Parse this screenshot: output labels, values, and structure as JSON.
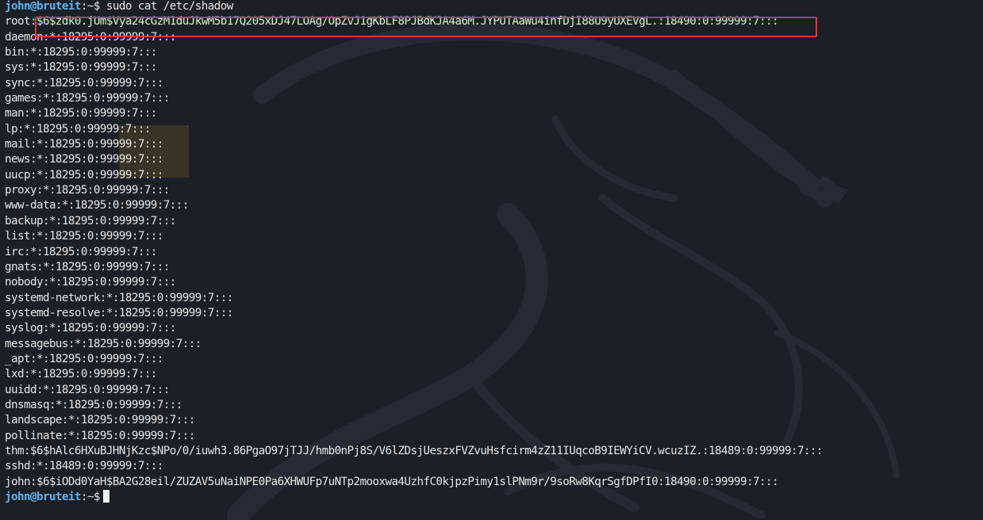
{
  "terminal": {
    "prompt_user": "john@bruteit",
    "prompt_sep": ":~$ ",
    "command": "sudo cat /etc/shadow",
    "final_prompt_user": "john@bruteit",
    "final_prompt_sep": ":~$"
  },
  "shadow_lines": [
    "root:$6$zdk0.jUm$Vya24cGzM1duJkwM5b17Q205xDJ47LOAg/OpZvJ1gKbLF8PJBdKJA4a6M.JYPUTAaWu4infDjI88U9yUXEVgL.:18490:0:99999:7:::",
    "daemon:*:18295:0:99999:7:::",
    "bin:*:18295:0:99999:7:::",
    "sys:*:18295:0:99999:7:::",
    "sync:*:18295:0:99999:7:::",
    "games:*:18295:0:99999:7:::",
    "man:*:18295:0:99999:7:::",
    "lp:*:18295:0:99999:7:::",
    "mail:*:18295:0:99999:7:::",
    "news:*:18295:0:99999:7:::",
    "uucp:*:18295:0:99999:7:::",
    "proxy:*:18295:0:99999:7:::",
    "www-data:*:18295:0:99999:7:::",
    "backup:*:18295:0:99999:7:::",
    "list:*:18295:0:99999:7:::",
    "irc:*:18295:0:99999:7:::",
    "gnats:*:18295:0:99999:7:::",
    "nobody:*:18295:0:99999:7:::",
    "systemd-network:*:18295:0:99999:7:::",
    "systemd-resolve:*:18295:0:99999:7:::",
    "syslog:*:18295:0:99999:7:::",
    "messagebus:*:18295:0:99999:7:::",
    "_apt:*:18295:0:99999:7:::",
    "lxd:*:18295:0:99999:7:::",
    "uuidd:*:18295:0:99999:7:::",
    "dnsmasq:*:18295:0:99999:7:::",
    "landscape:*:18295:0:99999:7:::",
    "pollinate:*:18295:0:99999:7:::",
    "thm:$6$hAlc6HXuBJHNjKzc$NPo/0/iuwh3.86PgaO97jTJJ/hmb0nPj8S/V6lZDsjUeszxFVZvuHsfcirm4zZ11IUqcoB9IEWYiCV.wcuzIZ.:18489:0:99999:7:::",
    "sshd:*:18489:0:99999:7:::",
    "john:$6$iODd0YaH$BA2G28eil/ZUZAV5uNaiNPE0Pa6XHWUFp7uNTp2mooxwa4UzhfC0kjpzPimy1slPNm9r/9soRw8KqrSgfDPfI0:18490:0:99999:7:::"
  ],
  "highlight": {
    "color": "#e0383b"
  },
  "colors": {
    "background": "#1c1f26",
    "prompt": "#5fb4f0",
    "text": "#e6e6e6"
  },
  "wallpaper_icon": "kali-dragon-icon"
}
